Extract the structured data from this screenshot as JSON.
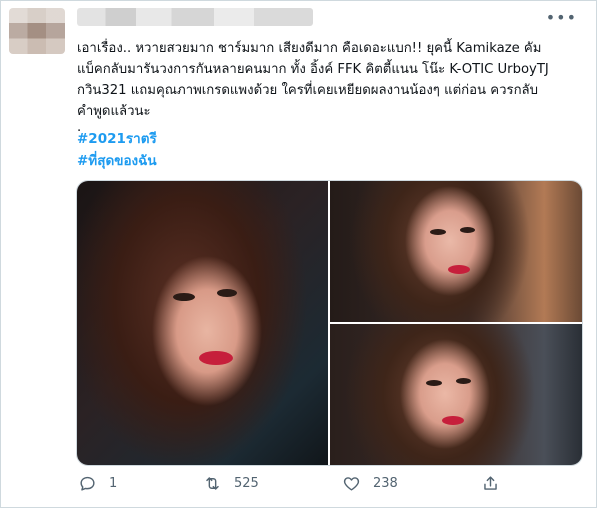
{
  "tweet": {
    "author": {
      "avatar": "blurred-avatar",
      "name": "blurred-name"
    },
    "more_icon": "more-dots-icon",
    "text_lines": [
      "เอาเรื่อง.. หวายสวยมาก ชาร์มมาก เสียงดีมาก คือเดอะแบก!! ยุคนี้ Kamikaze คัม",
      "แบ็คกลับมารันวงการกันหลายคนมาก ทั้ง อิ้งค์ FFK คิตตี้แนน โน๊ะ K-OTIC UrboyTJ",
      "กวิน321 แถมคุณภาพเกรดแพงด้วย ใครที่เคยเหยียดผลงานน้องๆ แต่ก่อน ควรกลับ",
      "คำพูดแล้วนะ",
      "."
    ],
    "hashtags": [
      "#2021ราตรี",
      "#ที่สุดของฉัน"
    ],
    "actions": {
      "reply": {
        "icon": "reply-icon",
        "count": "1"
      },
      "retweet": {
        "icon": "retweet-icon",
        "count": "525"
      },
      "like": {
        "icon": "heart-icon",
        "count": "238"
      },
      "share": {
        "icon": "share-icon"
      }
    },
    "colors": {
      "hashtag": "#1d9bf0",
      "icon_gray": "#536471",
      "text": "#0f1419",
      "border": "#cfd9de"
    }
  }
}
